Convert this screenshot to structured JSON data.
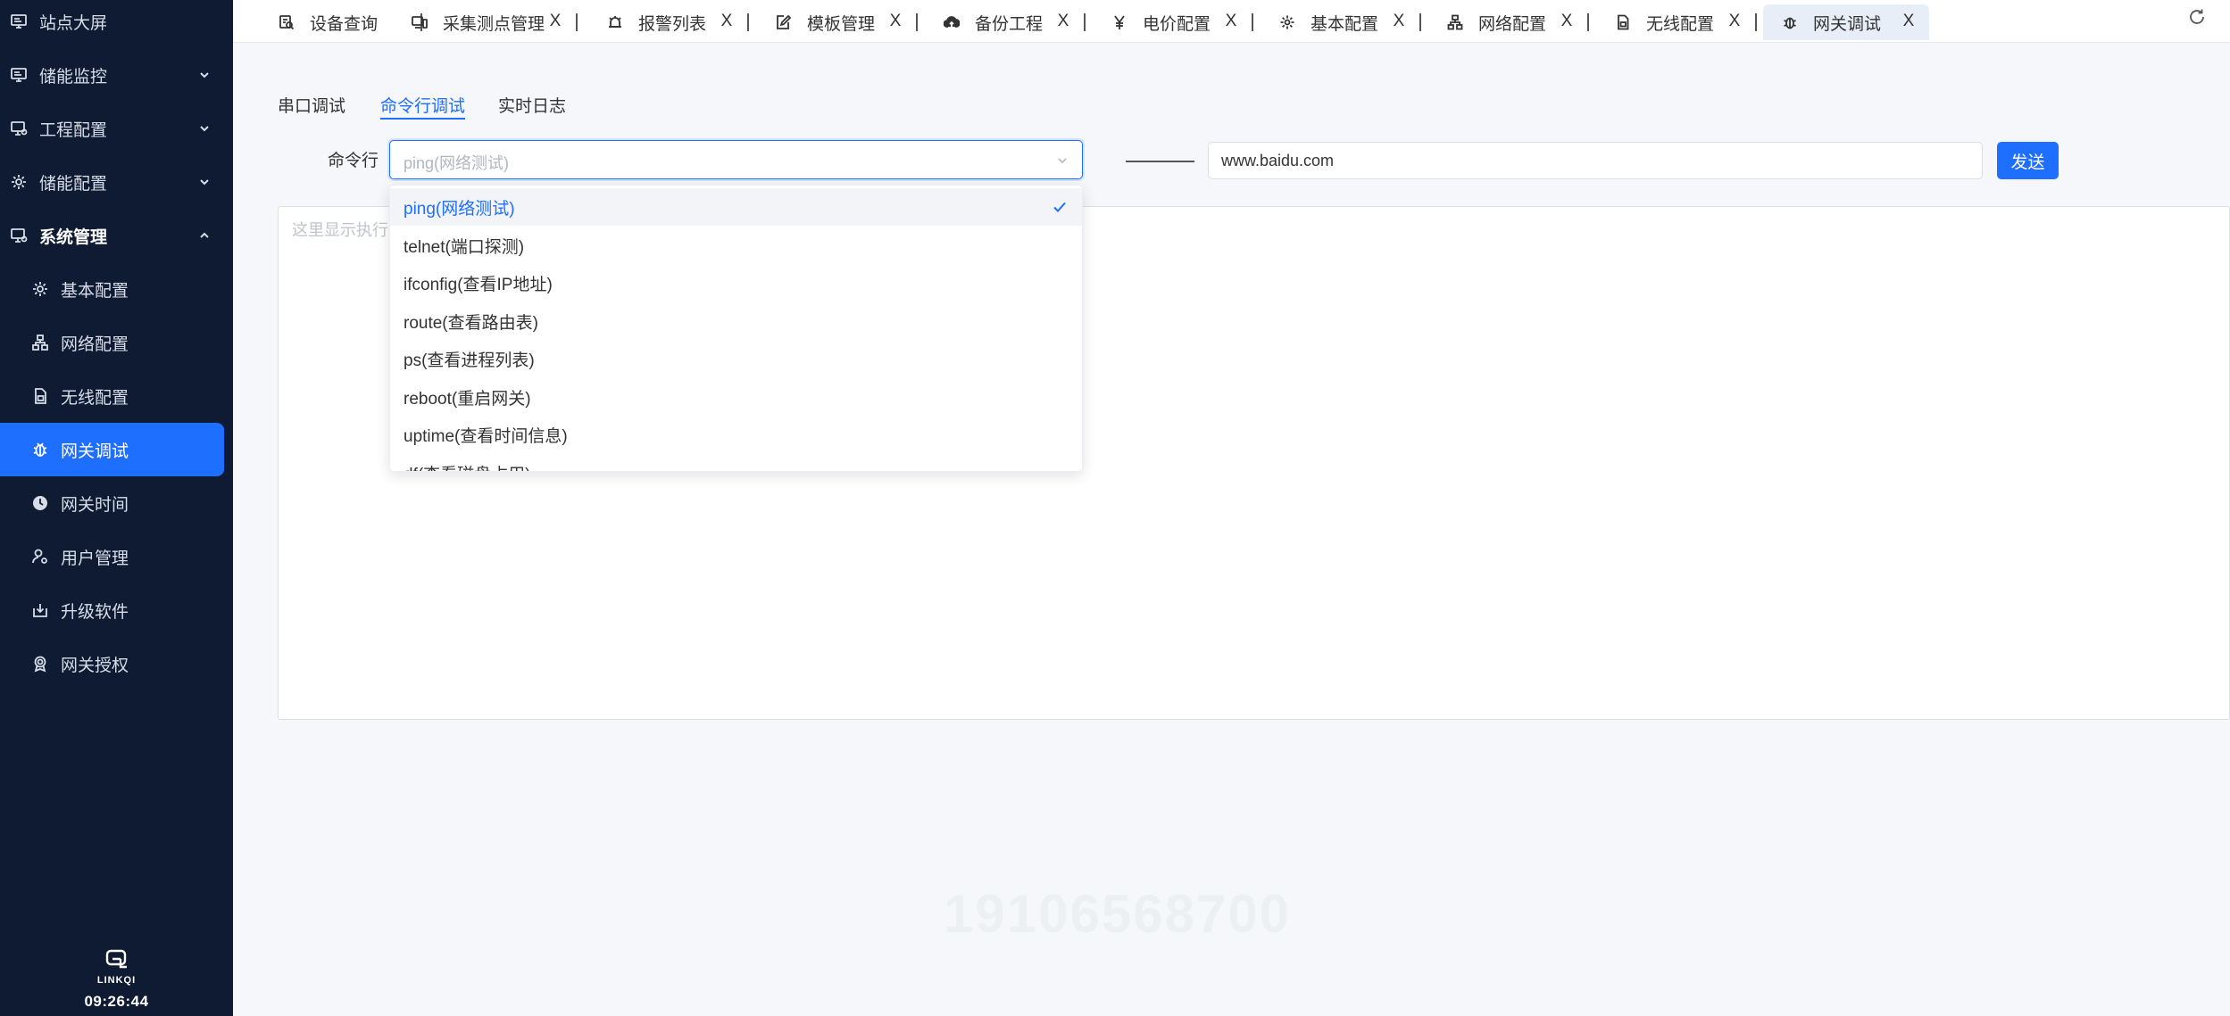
{
  "sidebar": {
    "items": [
      {
        "label": "站点大屏",
        "icon": "monitor-icon"
      },
      {
        "label": "储能监控",
        "icon": "monitor-icon"
      },
      {
        "label": "工程配置",
        "icon": "desktop-gear-icon"
      },
      {
        "label": "储能配置",
        "icon": "gear-icon"
      },
      {
        "label": "系统管理",
        "icon": "desktop-gear-icon"
      }
    ],
    "sub_items": [
      {
        "label": "基本配置",
        "icon": "gear-icon"
      },
      {
        "label": "网络配置",
        "icon": "network-icon"
      },
      {
        "label": "无线配置",
        "icon": "sim-card-icon"
      },
      {
        "label": "网关调试",
        "icon": "bug-icon"
      },
      {
        "label": "网关时间",
        "icon": "clock-icon"
      },
      {
        "label": "用户管理",
        "icon": "user-gear-icon"
      },
      {
        "label": "升级软件",
        "icon": "download-box-icon"
      },
      {
        "label": "网关授权",
        "icon": "badge-icon"
      }
    ],
    "logo_text": "LINKQI",
    "clock": "09:26:44"
  },
  "tabs": [
    {
      "label": "设备查询",
      "icon": "search-list-icon"
    },
    {
      "label": "采集测点管理",
      "icon": "devices-icon"
    },
    {
      "label": "报警列表",
      "icon": "alarm-icon"
    },
    {
      "label": "模板管理",
      "icon": "edit-doc-icon"
    },
    {
      "label": "备份工程",
      "icon": "cloud-upload-icon"
    },
    {
      "label": "电价配置",
      "icon": "yen-icon"
    },
    {
      "label": "基本配置",
      "icon": "gear-icon"
    },
    {
      "label": "网络配置",
      "icon": "network-icon"
    },
    {
      "label": "无线配置",
      "icon": "sim-card-icon"
    },
    {
      "label": "网关调试",
      "icon": "bug-icon"
    }
  ],
  "tab_close_glyph": "X",
  "subtabs": [
    "串口调试",
    "命令行调试",
    "实时日志"
  ],
  "command": {
    "label": "命令行",
    "selected": "ping(网络测试)",
    "target_value": "www.baidu.com",
    "send_label": "发送",
    "output_placeholder": "这里显示执行"
  },
  "dropdown_options": [
    "ping(网络测试)",
    "telnet(端口探测)",
    "ifconfig(查看IP地址)",
    "route(查看路由表)",
    "ps(查看进程列表)",
    "reboot(重启网关)",
    "uptime(查看时间信息)",
    "df(查看磁盘占用)"
  ],
  "watermark": "19106568700",
  "colors": {
    "accent": "#1f6fff",
    "sidebar_bg": "#0e1b33"
  }
}
